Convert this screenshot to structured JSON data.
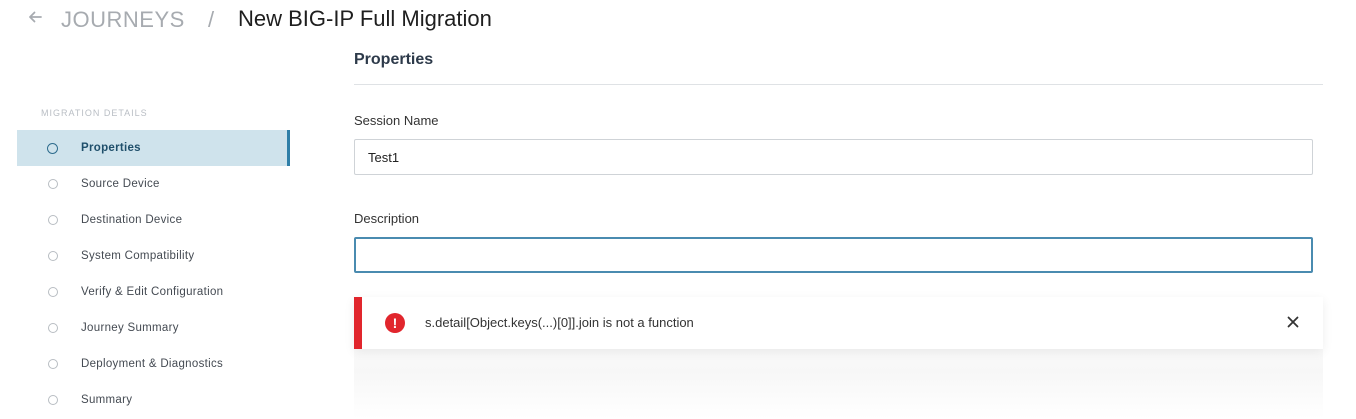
{
  "header": {
    "back_icon": "arrow-left-icon",
    "breadcrumb_root": "JOURNEYS",
    "separator": "/",
    "title": "New BIG-IP Full Migration"
  },
  "sidebar": {
    "heading": "MIGRATION DETAILS",
    "items": [
      {
        "label": "Properties",
        "active": true
      },
      {
        "label": "Source Device",
        "active": false
      },
      {
        "label": "Destination Device",
        "active": false
      },
      {
        "label": "System Compatibility",
        "active": false
      },
      {
        "label": "Verify & Edit Configuration",
        "active": false
      },
      {
        "label": "Journey Summary",
        "active": false
      },
      {
        "label": "Deployment & Diagnostics",
        "active": false
      },
      {
        "label": "Summary",
        "active": false
      }
    ]
  },
  "main": {
    "section_title": "Properties",
    "session_name": {
      "label": "Session Name",
      "value": "Test1",
      "placeholder": ""
    },
    "description": {
      "label": "Description",
      "value": "",
      "placeholder": ""
    }
  },
  "alert": {
    "icon": "error-icon",
    "icon_glyph": "!",
    "message": "s.detail[Object.keys(...)[0]].join is not a function",
    "close_icon": "close-icon",
    "color": "#e1262d"
  },
  "colors": {
    "accent": "#2f7fa8",
    "active_bg": "#cfe3ec",
    "error": "#e1262d"
  }
}
